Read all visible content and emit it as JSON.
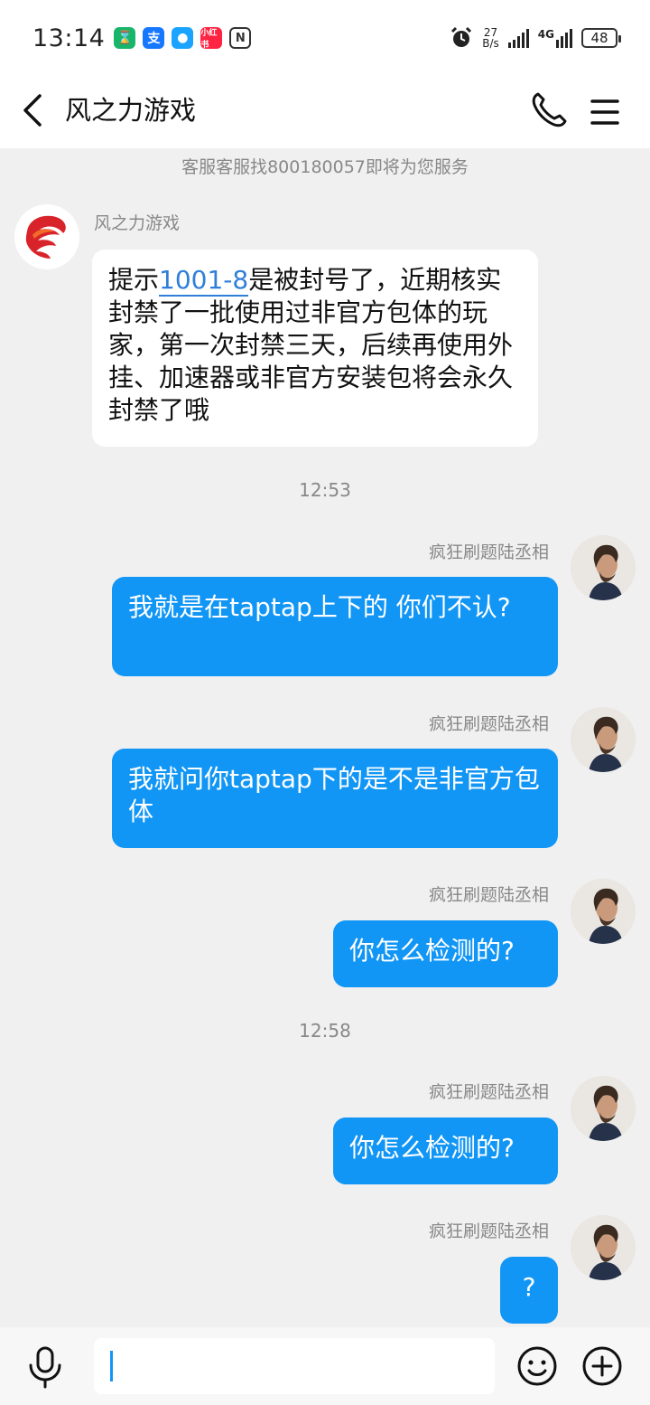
{
  "status_bar": {
    "time": "13:14",
    "net_speed_value": "27",
    "net_speed_unit": "B/s",
    "network": "4G",
    "battery": "48",
    "app_icons": [
      "hourglass-app-icon",
      "alipay-app-icon",
      "message-app-icon",
      "xiaohongshu-app-icon",
      "nfc-icon"
    ]
  },
  "header": {
    "title": "风之力游戏"
  },
  "notice": "客服客服找800180057即将为您服务",
  "messages": [
    {
      "sender": "风之力游戏",
      "text_before": "提示",
      "link": "1001-8",
      "text_after": "是被封号了，近期核实封禁了一批使用过非官方包体的玩家，第一次封禁三天，后续再使用外挂、加速器或非官方安装包将会永久封禁了哦"
    },
    {
      "sender": "疯狂刷题陆丞相",
      "text": "我就是在taptap上下的 你们不认?"
    },
    {
      "sender": "疯狂刷题陆丞相",
      "text": "我就问你taptap下的是不是非官方包体"
    },
    {
      "sender": "疯狂刷题陆丞相",
      "text": "你怎么检测的?"
    },
    {
      "sender": "疯狂刷题陆丞相",
      "text": "你怎么检测的?"
    },
    {
      "sender": "疯狂刷题陆丞相",
      "text": "?"
    }
  ],
  "timestamps": [
    "12:53",
    "12:58"
  ],
  "colors": {
    "accent": "#1296f5",
    "background": "#f0f0f0",
    "link": "#2f7fd8"
  }
}
